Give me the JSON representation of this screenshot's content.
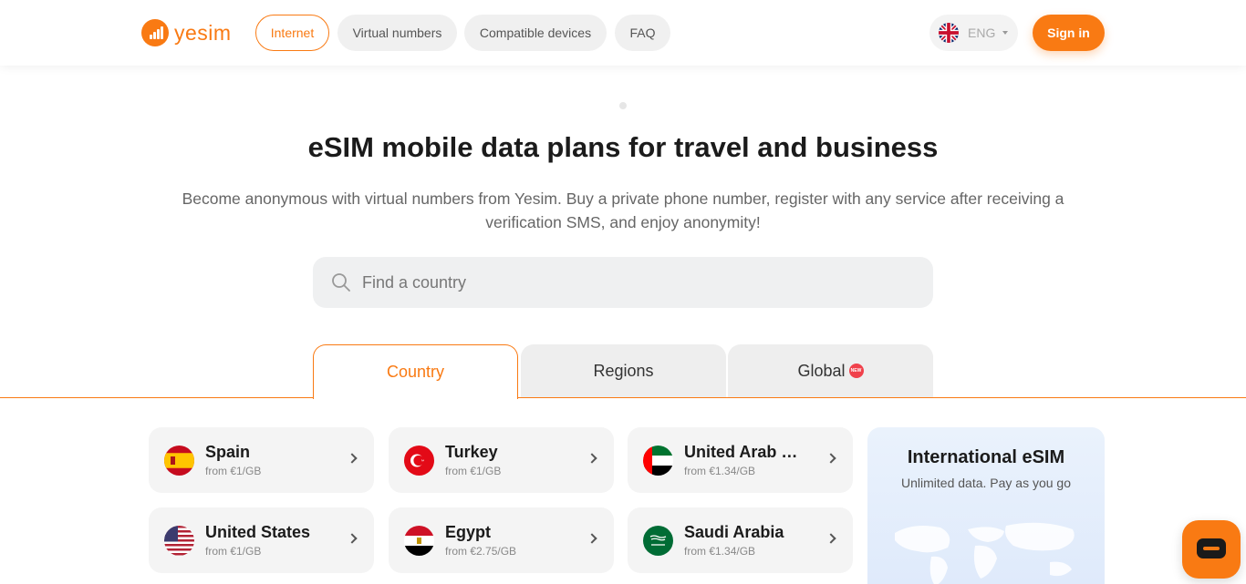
{
  "brand": {
    "name": "yesim",
    "accent": "#f97a13"
  },
  "nav": {
    "items": [
      {
        "label": "Internet",
        "active": true
      },
      {
        "label": "Virtual numbers",
        "active": false
      },
      {
        "label": "Compatible devices",
        "active": false
      },
      {
        "label": "FAQ",
        "active": false
      }
    ],
    "language": "ENG",
    "signin_label": "Sign in"
  },
  "hero": {
    "title": "eSIM mobile data plans for travel and business",
    "subtitle": "Become anonymous with virtual numbers from Yesim. Buy a private phone number, register with any service after receiving a verification SMS, and enjoy anonymity!"
  },
  "search": {
    "placeholder": "Find a country"
  },
  "tabs": [
    {
      "label": "Country",
      "active": true
    },
    {
      "label": "Regions",
      "active": false
    },
    {
      "label": "Global",
      "active": false,
      "badge": "NEW"
    }
  ],
  "countries": [
    {
      "name": "Spain",
      "price": "from €1/GB",
      "flag": "spain-flag"
    },
    {
      "name": "Turkey",
      "price": "from €1/GB",
      "flag": "turkey-flag"
    },
    {
      "name": "United Arab Emirates",
      "price": "from €1.34/GB",
      "flag": "uae-flag"
    },
    {
      "name": "United States",
      "price": "from €1/GB",
      "flag": "us-flag"
    },
    {
      "name": "Egypt",
      "price": "from €2.75/GB",
      "flag": "egypt-flag"
    },
    {
      "name": "Saudi Arabia",
      "price": "from €1.34/GB",
      "flag": "saudi-flag"
    }
  ],
  "international": {
    "title": "International eSIM",
    "subtitle": "Unlimited data. Pay as you go"
  }
}
